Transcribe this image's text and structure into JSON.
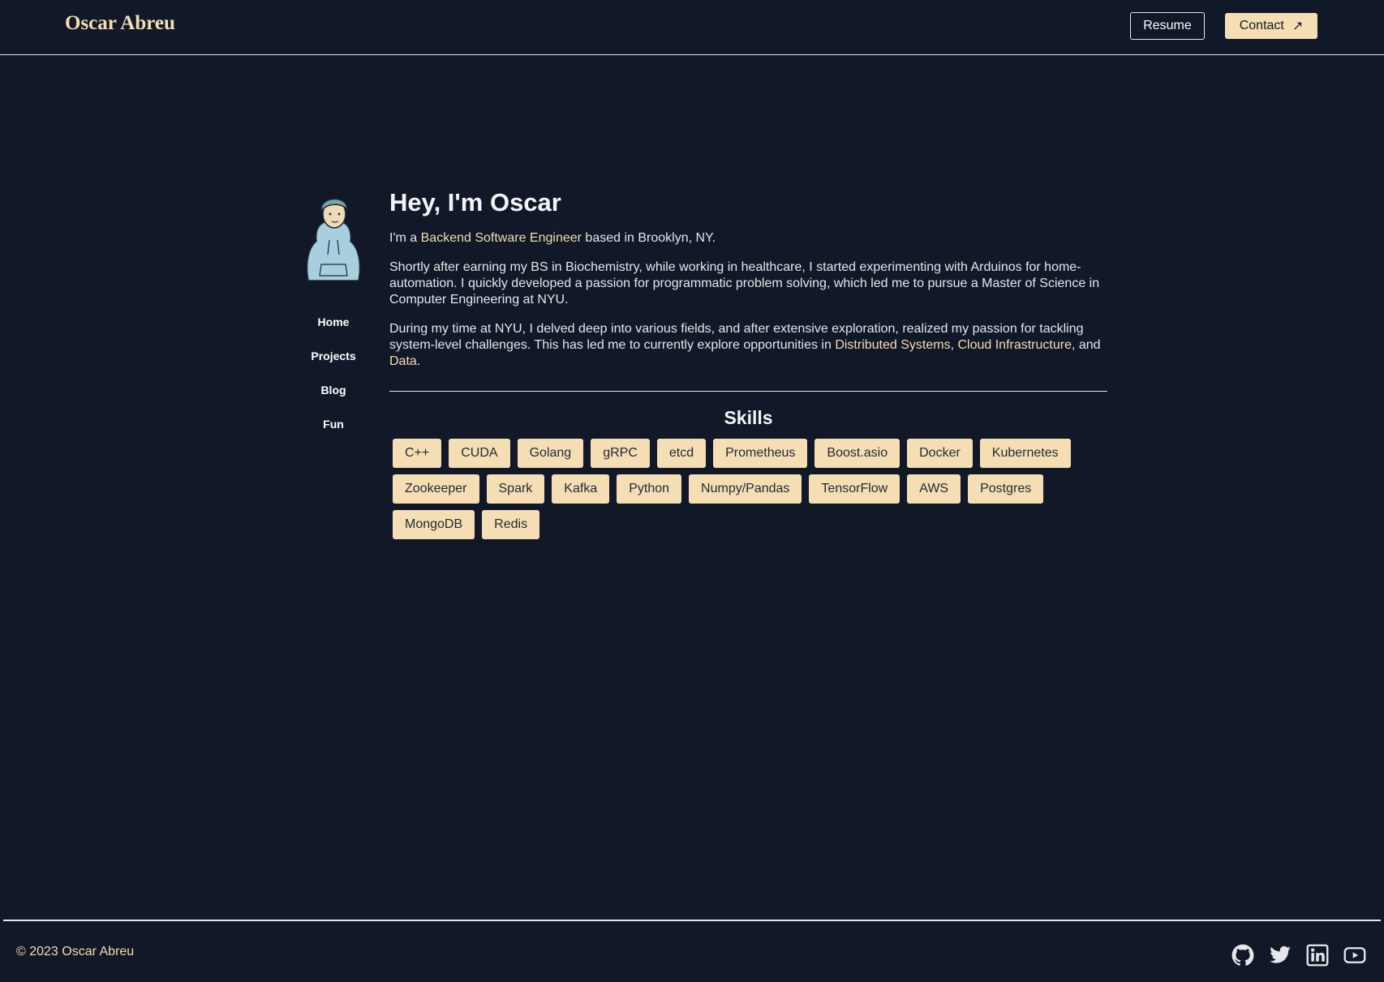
{
  "header": {
    "brand": "Oscar Abreu",
    "resume_label": "Resume",
    "contact_label": "Contact",
    "contact_icon": "↗"
  },
  "nav": {
    "items": [
      {
        "label": "Home"
      },
      {
        "label": "Projects"
      },
      {
        "label": "Blog"
      },
      {
        "label": "Fun"
      }
    ]
  },
  "main": {
    "title": "Hey, I'm Oscar",
    "intro": {
      "prefix": "I'm a ",
      "role": "Backend Software Engineer",
      "suffix": " based in Brooklyn, NY."
    },
    "paragraph2": "Shortly after earning my BS in Biochemistry, while working in healthcare, I started experimenting with Arduinos for home-automation. I quickly developed a passion for programmatic problem solving, which led me to pursue a Master of Science in Computer Engineering at NYU.",
    "paragraph3": {
      "text": "During my time at NYU, I delved deep into various fields, and after extensive exploration, realized my passion for tackling system-level challenges. This has led me to currently explore opportunities in ",
      "link1": "Distributed Systems",
      "sep1": ", ",
      "link2": "Cloud Infrastructure",
      "sep2": ", and ",
      "link3": "Data",
      "end": "."
    },
    "skills_title": "Skills",
    "skills": [
      "C++",
      "CUDA",
      "Golang",
      "gRPC",
      "etcd",
      "Prometheus",
      "Boost.asio",
      "Docker",
      "Kubernetes",
      "Zookeeper",
      "Spark",
      "Kafka",
      "Python",
      "Numpy/Pandas",
      "TensorFlow",
      "AWS",
      "Postgres",
      "MongoDB",
      "Redis"
    ]
  },
  "footer": {
    "copyright": "© 2023 Oscar Abreu",
    "socials": [
      "github-icon",
      "twitter-icon",
      "linkedin-icon",
      "youtube-icon"
    ]
  },
  "colors": {
    "background": "#111827",
    "accent": "#f5deb3",
    "text": "#e5e7eb"
  }
}
